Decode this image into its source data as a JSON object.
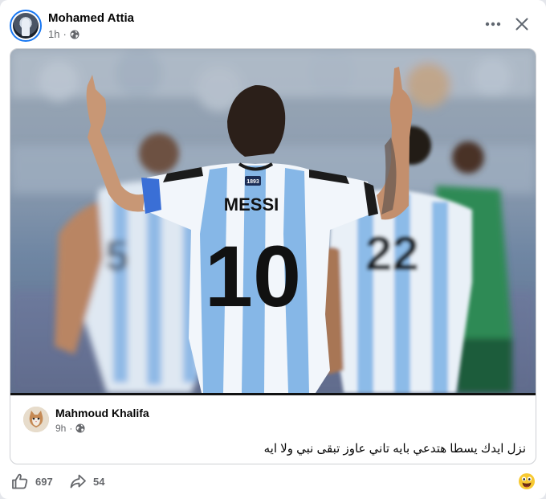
{
  "post": {
    "author_name": "Mohamed Attia",
    "time": "1h",
    "separator": "·",
    "privacy_icon": "globe-icon"
  },
  "header_actions": {
    "more_icon": "more-horizontal-icon",
    "close_icon": "close-icon"
  },
  "shared_photo": {
    "player_name": "MESSI",
    "player_number": "10",
    "teammate_number": "22",
    "left_number": "5",
    "badge_text": "1893"
  },
  "shared_comment": {
    "author_name": "Mahmoud Khalifa",
    "time": "9h",
    "separator": "·",
    "privacy_icon": "globe-icon",
    "text": "نزل ايدك يسطا هتدعي بايه تاني عاوز تبقى نبي ولا ايه"
  },
  "footer": {
    "like_icon": "thumbs-up-icon",
    "like_count": "697",
    "share_icon": "share-arrow-icon",
    "share_count": "54",
    "emoji_icon": "emoji-reaction-icon"
  },
  "colors": {
    "accent": "#1877f2",
    "secondary_text": "#65676b",
    "primary_text": "#050505"
  }
}
